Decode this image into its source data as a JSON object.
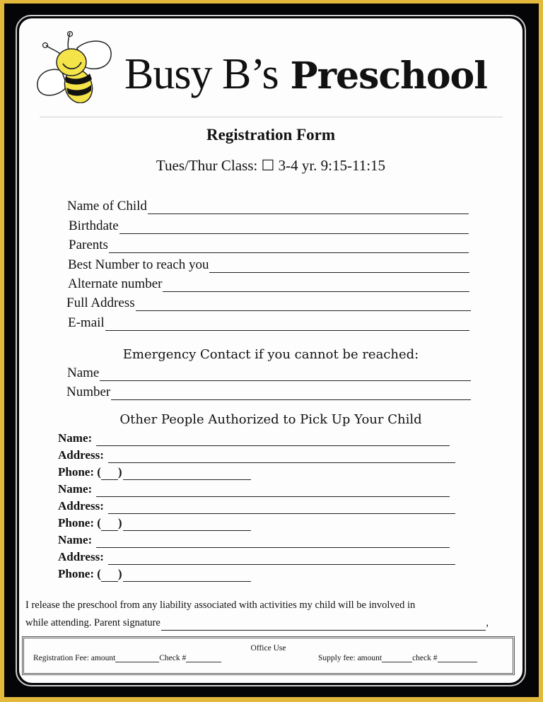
{
  "colors": {
    "outer_border": "#e2b93b",
    "frame": "#050407",
    "paper": "#fdfdfd",
    "bee_yellow": "#f4e44a"
  },
  "header": {
    "logo_icon": "bee-icon",
    "name_light": "Busy B’s",
    "name_bold": "Preschool"
  },
  "form": {
    "title": "Registration Form",
    "class_label": "Tues/Thur Class:",
    "checkbox_glyph": "☐",
    "class_option": "3-4 yr. 9:15-11:15",
    "child_fields": [
      {
        "label": "Name of Child",
        "value": ""
      },
      {
        "label": "Birthdate",
        "value": ""
      },
      {
        "label": "Parents",
        "value": ""
      },
      {
        "label": "Best Number to reach you",
        "value": ""
      },
      {
        "label": "Alternate number",
        "value": ""
      },
      {
        "label": "Full Address",
        "value": ""
      },
      {
        "label": "E-mail",
        "value": ""
      }
    ],
    "emergency": {
      "heading": "Emergency Contact if you cannot be reached:",
      "fields": [
        {
          "label": "Name",
          "value": ""
        },
        {
          "label": "Number",
          "value": ""
        }
      ]
    },
    "pickup": {
      "heading": "Other People Authorized to Pick Up Your Child",
      "people": [
        {
          "name_label": "Name:",
          "address_label": "Address:",
          "phone_label": "Phone: (",
          "phone_close": ")"
        },
        {
          "name_label": "Name:",
          "address_label": "Address:",
          "phone_label": "Phone: (",
          "phone_close": ")"
        },
        {
          "name_label": "Name:",
          "address_label": "Address:",
          "phone_label": "Phone: (",
          "phone_close": ")"
        }
      ]
    },
    "release": {
      "line1": "I release the preschool from any liability associated with activities my child will be involved in",
      "line2_prefix": "while attending.  Parent signature",
      "line2_suffix": ","
    },
    "office_use": {
      "title": "Office Use",
      "registration_fee_label": "Registration Fee: amount",
      "registration_check_label": "Check #",
      "supply_fee_label": "Supply fee: amount",
      "supply_check_label": "check #"
    }
  }
}
